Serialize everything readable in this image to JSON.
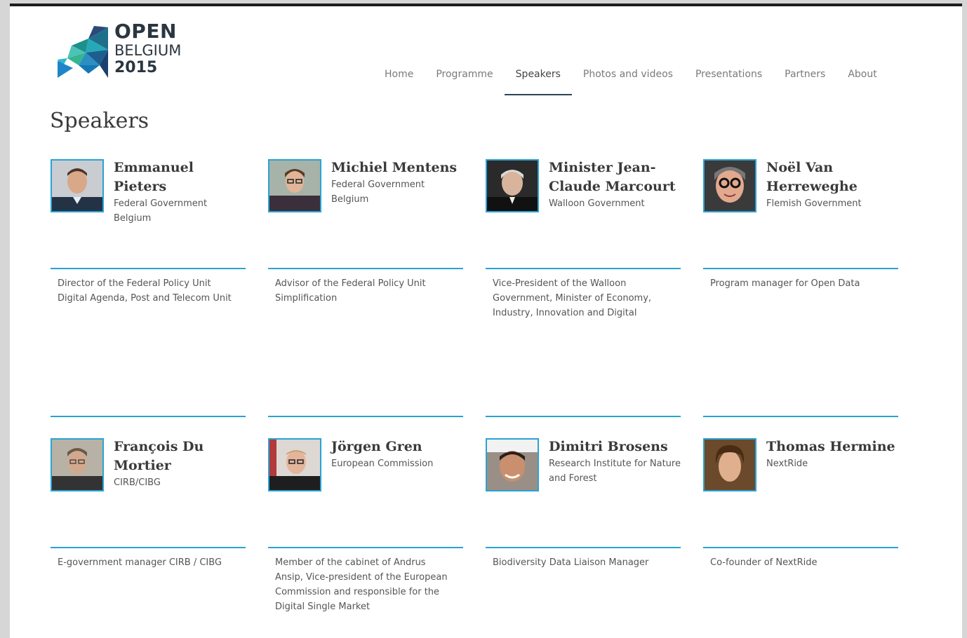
{
  "logo": {
    "line1": "OPEN",
    "line2": "BELGIUM",
    "line3": "2015"
  },
  "nav": {
    "items": [
      {
        "label": "Home",
        "active": false
      },
      {
        "label": "Programme",
        "active": false
      },
      {
        "label": "Speakers",
        "active": true
      },
      {
        "label": "Photos and videos",
        "active": false
      },
      {
        "label": "Presentations",
        "active": false
      },
      {
        "label": "Partners",
        "active": false
      },
      {
        "label": "About",
        "active": false
      }
    ]
  },
  "page": {
    "title": "Speakers"
  },
  "speakers": [
    {
      "name": "Emmanuel Pieters",
      "org": "Federal Government Belgium",
      "role": "Director of the Federal Policy Unit Digital Agenda, Post and Telecom Unit"
    },
    {
      "name": "Michiel Mentens",
      "org": "Federal Government Belgium",
      "role": "Advisor of the Federal Policy Unit Simplification"
    },
    {
      "name": "Minister Jean-Claude Marcourt",
      "org": "Walloon Government",
      "role": "Vice-President of the Walloon Government, Minister of Economy, Industry, Innovation and Digital"
    },
    {
      "name": "Noël Van Herreweghe",
      "org": "Flemish Government",
      "role": "Program manager for Open Data"
    },
    {
      "name": "François Du Mortier",
      "org": "CIRB/CIBG",
      "role": "E-government manager CIRB / CIBG"
    },
    {
      "name": "Jörgen Gren",
      "org": "European Commission",
      "role": "Member of the cabinet of Andrus Ansip, Vice-president of the European Commission and responsible for the Digital Single Market"
    },
    {
      "name": "Dimitri Brosens",
      "org": "Research Institute for Nature and Forest",
      "role": "Biodiversity Data Liaison Manager"
    },
    {
      "name": "Thomas Hermine",
      "org": "NextRide",
      "role": "Co-founder of NextRide"
    }
  ],
  "colors": {
    "accent": "#29a3d5",
    "nav_active": "#2d4456",
    "text": "#3a3a3a"
  }
}
